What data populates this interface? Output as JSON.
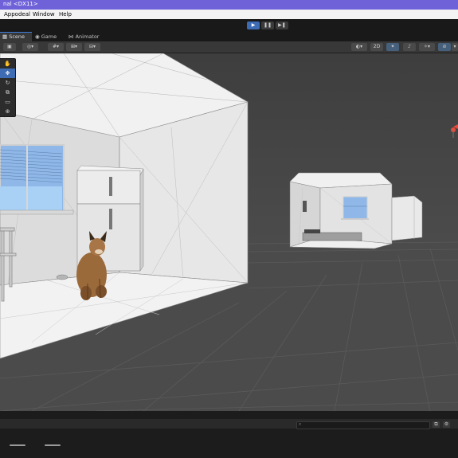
{
  "window": {
    "title": "nal <DX11>"
  },
  "menu": {
    "items": [
      "Appodeal",
      "Window",
      "Help"
    ]
  },
  "play_controls": {
    "play": "▶",
    "pause": "❚❚",
    "step": "▶❚"
  },
  "tabs": [
    {
      "label": "Scene",
      "icon": "grid-icon",
      "active": true
    },
    {
      "label": "Game",
      "icon": "gamepad-icon",
      "active": false
    },
    {
      "label": "Animator",
      "icon": "animator-icon",
      "active": false
    }
  ],
  "scene_toolbar": {
    "mode_2d": "2D"
  },
  "tools": [
    "hand-tool",
    "move-tool",
    "rotate-tool",
    "scale-tool",
    "rect-tool",
    "transform-tool"
  ],
  "colors": {
    "title_bar": "#6f62d8",
    "accent": "#3d6cb5",
    "viewport_bg": "#484848",
    "window_sky": "#8fb8e8"
  },
  "console": {
    "search_placeholder": ""
  }
}
